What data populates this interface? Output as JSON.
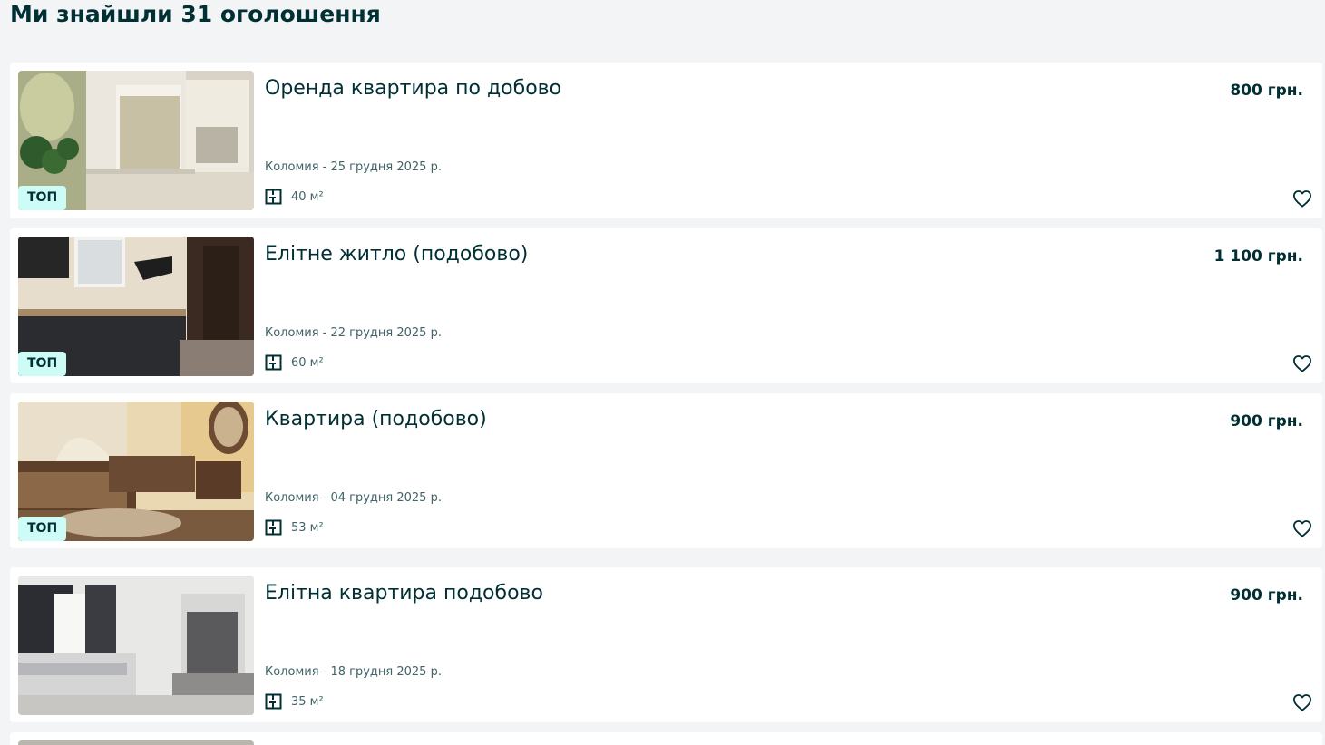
{
  "header": {
    "title": "Ми знайшли 31 оголошення"
  },
  "listings": [
    {
      "title": "Оренда квартира по добово",
      "price": "800 грн.",
      "location_date": "Коломия - 25 грудня 2025 р.",
      "area": "40 м²",
      "badge": "ТОП"
    },
    {
      "title": "Елітне житло (подобово)",
      "price": "1 100 грн.",
      "location_date": "Коломия - 22 грудня 2025 р.",
      "area": "60 м²",
      "badge": "ТОП"
    },
    {
      "title": "Квартира (подобово)",
      "price": "900 грн.",
      "location_date": "Коломия - 04 грудня 2025 р.",
      "area": "53 м²",
      "badge": "ТОП"
    },
    {
      "title": "Елітна квартира подобово",
      "price": "900 грн.",
      "location_date": "Коломия - 18 грудня 2025 р.",
      "area": "35 м²"
    }
  ],
  "icons": {
    "area": "floor-plan-icon",
    "favorite": "heart-outline-icon"
  },
  "colors": {
    "text": "#002f34",
    "muted": "#406367",
    "badge_bg": "#ccfcf5",
    "page_bg": "#f2f4f5"
  }
}
